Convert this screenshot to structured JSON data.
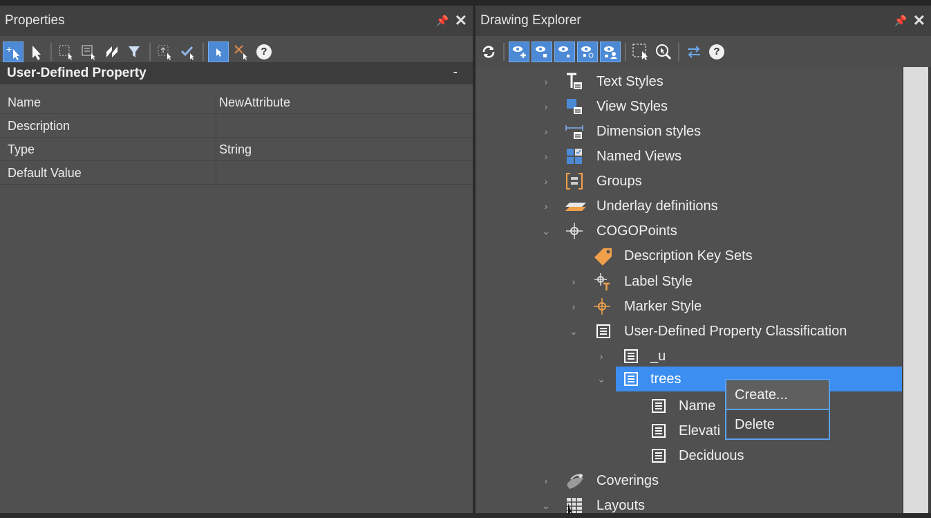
{
  "properties": {
    "title": "Properties",
    "section_title": "User-Defined Property",
    "collapse_glyph": "-",
    "rows": [
      {
        "name": "Name",
        "value": "NewAttribute"
      },
      {
        "name": "Description",
        "value": ""
      },
      {
        "name": "Type",
        "value": "String"
      },
      {
        "name": "Default Value",
        "value": ""
      }
    ],
    "toolbar_icons": [
      "add-select-icon",
      "select-arrow-icon",
      "window-select-icon",
      "crossing-select-icon",
      "select-all-icon",
      "filter-select-icon",
      "quick-select-icon",
      "accept-select-icon",
      "pickadd-toggle-icon",
      "deselect-icon",
      "help-icon"
    ]
  },
  "explorer": {
    "title": "Drawing Explorer",
    "toolbar_icons": [
      "refresh-icon",
      "view-add-icon",
      "view-point-icon",
      "view-small-icon",
      "view-dots-icon",
      "view-person-icon",
      "select-window-icon",
      "zoom-icon",
      "sync-icon",
      "help-icon"
    ],
    "help_glyph": "?",
    "tree": [
      {
        "label": "Text Styles",
        "icon": "text-styles-icon",
        "state": "collapsed"
      },
      {
        "label": "View Styles",
        "icon": "view-styles-icon",
        "state": "collapsed"
      },
      {
        "label": "Dimension styles",
        "icon": "dimension-styles-icon",
        "state": "collapsed"
      },
      {
        "label": "Named Views",
        "icon": "named-views-icon",
        "state": "collapsed"
      },
      {
        "label": "Groups",
        "icon": "groups-icon",
        "state": "collapsed"
      },
      {
        "label": "Underlay definitions",
        "icon": "underlay-icon",
        "state": "collapsed"
      },
      {
        "label": "COGOPoints",
        "icon": "cogo-point-icon",
        "state": "expanded"
      },
      {
        "label": "Description Key Sets",
        "icon": "tag-icon",
        "state": "leaf"
      },
      {
        "label": "Label Style",
        "icon": "label-style-icon",
        "state": "collapsed"
      },
      {
        "label": "Marker Style",
        "icon": "marker-style-icon",
        "state": "collapsed"
      },
      {
        "label": "User-Defined Property Classification",
        "icon": "list-icon",
        "state": "expanded"
      },
      {
        "label": "_u",
        "icon": "list-icon",
        "state": "collapsed"
      },
      {
        "label": "trees",
        "icon": "list-icon",
        "state": "expanded",
        "selected": true
      },
      {
        "label": "Name",
        "icon": "list-icon",
        "state": "leaf"
      },
      {
        "label": "Elevati",
        "icon": "list-icon",
        "state": "leaf"
      },
      {
        "label": "Deciduous",
        "icon": "list-icon",
        "state": "leaf"
      },
      {
        "label": "Coverings",
        "icon": "coverings-icon",
        "state": "collapsed"
      },
      {
        "label": "Layouts",
        "icon": "layouts-icon",
        "state": "expanded"
      }
    ]
  },
  "context_menu": {
    "items": [
      "Create...",
      "Delete"
    ]
  },
  "colors": {
    "accent": "#3c8ef0",
    "panel": "#505050",
    "titlebar": "#404040"
  }
}
